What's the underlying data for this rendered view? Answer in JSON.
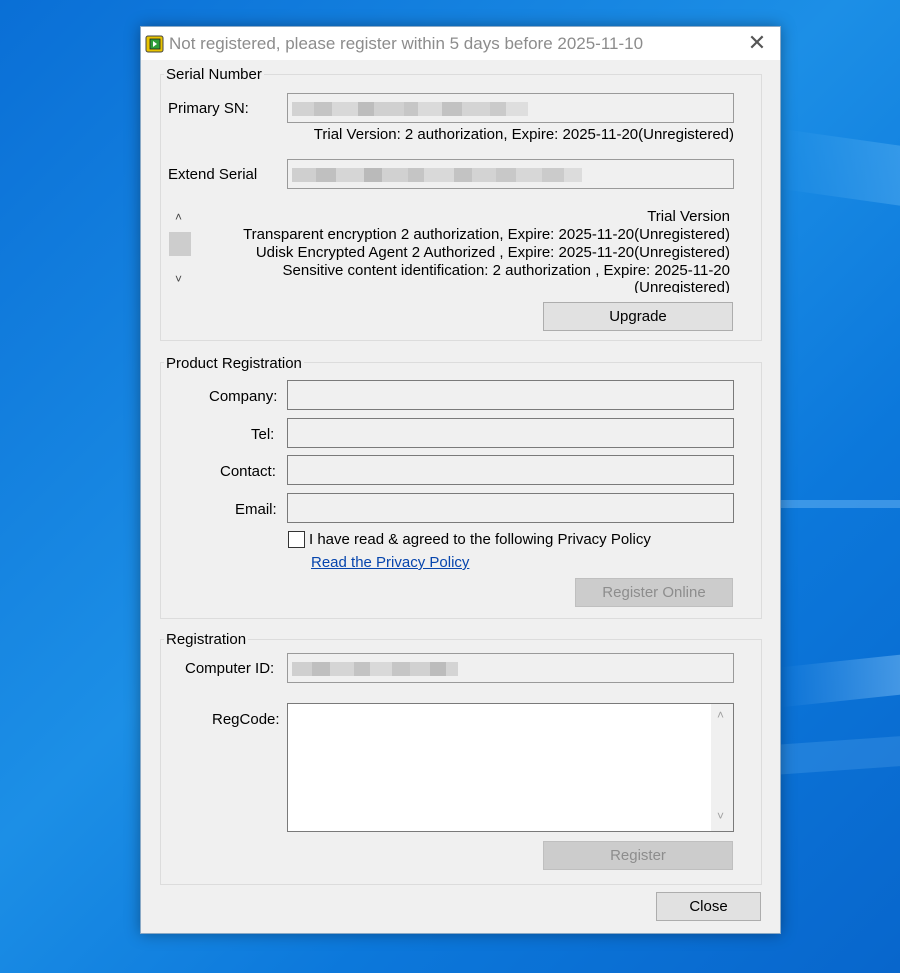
{
  "window": {
    "title": "Not registered, please register within 5 days before 2025-11-10",
    "close_glyph": "✕"
  },
  "serial_number": {
    "group_title": "Serial Number",
    "primary_sn_label": "Primary SN:",
    "primary_sn_status": "Trial Version: 2 authorization, Expire: 2025-11-20(Unregistered)",
    "extend_serial_label": "Extend Serial",
    "extend_info": [
      "Trial Version",
      "Transparent encryption 2 authorization, Expire: 2025-11-20(Unregistered)",
      "Udisk Encrypted Agent 2 Authorized , Expire: 2025-11-20(Unregistered)",
      "Sensitive content identification: 2 authorization , Expire: 2025-11-20",
      "(Unregistered)"
    ],
    "upgrade_button": "Upgrade"
  },
  "product_registration": {
    "group_title": "Product Registration",
    "company_label": "Company:",
    "tel_label": "Tel:",
    "contact_label": "Contact:",
    "email_label": "Email:",
    "privacy_checkbox_label": "I have read & agreed to the following Privacy Policy",
    "privacy_link": "Read the Privacy Policy",
    "register_online_button": "Register Online"
  },
  "registration": {
    "group_title": "Registration",
    "computer_id_label": "Computer ID:",
    "regcode_label": "RegCode:",
    "register_button": "Register"
  },
  "close_button": "Close",
  "icons": {
    "app": "app-icon",
    "scroll_up": "chevron-up-icon",
    "scroll_down": "chevron-down-icon"
  }
}
